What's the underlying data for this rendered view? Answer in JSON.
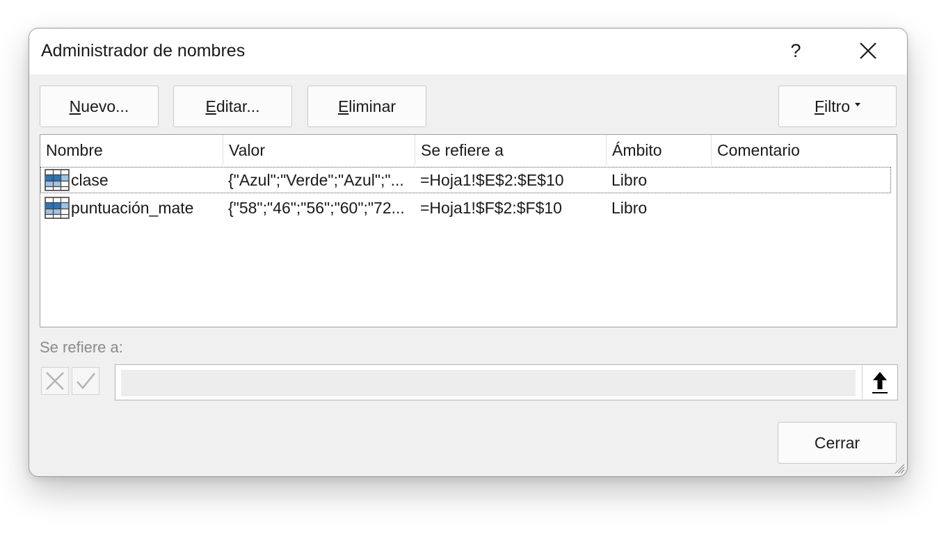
{
  "dialog": {
    "title": "Administrador de nombres",
    "help_label": "?"
  },
  "toolbar": {
    "new_accel": "N",
    "new_rest": "uevo...",
    "edit_accel": "E",
    "edit_rest": "ditar...",
    "delete_accel": "E",
    "delete_rest": "liminar",
    "filter_accel": "F",
    "filter_rest": "iltro"
  },
  "table": {
    "columns": [
      "Nombre",
      "Valor",
      "Se refiere a",
      "Ámbito",
      "Comentario"
    ],
    "rows": [
      {
        "name": "clase",
        "value": "{\"Azul\";\"Verde\";\"Azul\";\"...",
        "refers_to": "=Hoja1!$E$2:$E$10",
        "scope": "Libro",
        "comment": "",
        "icon": "table-name-icon"
      },
      {
        "name": "puntuación_mate",
        "value": "{\"58\";\"46\";\"56\";\"60\";\"72...",
        "refers_to": "=Hoja1!$F$2:$F$10",
        "scope": "Libro",
        "comment": "",
        "icon": "table-name-icon"
      }
    ]
  },
  "refers_to": {
    "label": "Se refiere a:",
    "value": ""
  },
  "footer": {
    "close_label": "Cerrar"
  },
  "colors": {
    "dialog_bg": "#f0f0f0",
    "titlebar_bg": "#ffffff",
    "icon_blue": "#2e75b6",
    "icon_cell_blue": "#9dc3e6"
  }
}
